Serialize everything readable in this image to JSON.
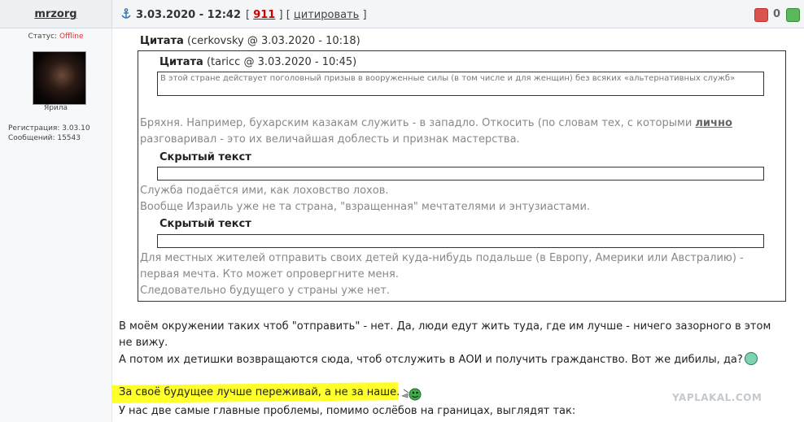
{
  "post": {
    "username": "mrzorg",
    "date": "3.03.2020 - 12:42",
    "bracket_open": "[",
    "reply_count": "911",
    "mid": "] [",
    "quote_link": "цитировать",
    "bracket_close": "]",
    "votes": "0"
  },
  "user": {
    "status_label": "Статус:",
    "status_value": "Offline",
    "avatar_caption": "Ярила",
    "reg_line": "Регистрация: 3.03.10",
    "posts_line": "Сообщений: 15543"
  },
  "quote_outer": {
    "title": "Цитата",
    "meta": "(cerkovsky @ 3.03.2020 - 10:18)"
  },
  "quote_inner": {
    "title": "Цитата",
    "meta": "(taricc @ 3.03.2020 - 10:45)",
    "text": "В этой стране действует поголовный призыв в вооруженные силы (в том числе и для женщин) без всяких «альтернативных служб»"
  },
  "quote_body": {
    "p1_a": "Бряхня. Например, бухарским казакам служить - в западло. Откосить (по словам тех, с которыми ",
    "p1_em": "лично",
    "p1_b": " разговаривал - это их величайшая доблесть и признак мастерства.",
    "hidden1": "Скрытый текст",
    "p2": "Служба подаётся ими, как лоховство лохов.",
    "p3": "Вообще Израиль уже не та страна, \"взращенная\" мечтателями и энтузиастами.",
    "hidden2": "Скрытый текст",
    "p4": "Для местных жителей отправить своих детей куда-нибудь подальше (в Европу, Америки или Австралию) - первая мечта. Кто может опровергните меня.",
    "p5": "Следовательно будущего у страны уже нет."
  },
  "reply": {
    "p1": "В моём окружении таких чтоб \"отправить\" - нет. Да, люди едут жить туда, где им лучше - ничего зазорного в этом не вижу.",
    "p2": "А потом их детишки возвращаются сюда, чтоб отслужить в АОИ и получить гражданство. Вот же дибилы, да?",
    "p3": "За своё будущее лучше переживай, а не за наше.",
    "p4": "У нас две самые главные проблемы, помимо ослёбов на границах, выглядят так:"
  },
  "watermark": "YAPLAKAL.COM",
  "icons": {
    "anchor": "anchor-icon",
    "vote_down": "thumbs-down-icon",
    "vote_up": "thumbs-up-icon",
    "smile_green": "green-smiley-icon",
    "smile_jet": "jetpack-smiley-icon"
  },
  "colors": {
    "accent_red": "#cc0000",
    "highlight": "#ffff2a",
    "vote_down": "#d9534f",
    "vote_up": "#5cb85c"
  }
}
